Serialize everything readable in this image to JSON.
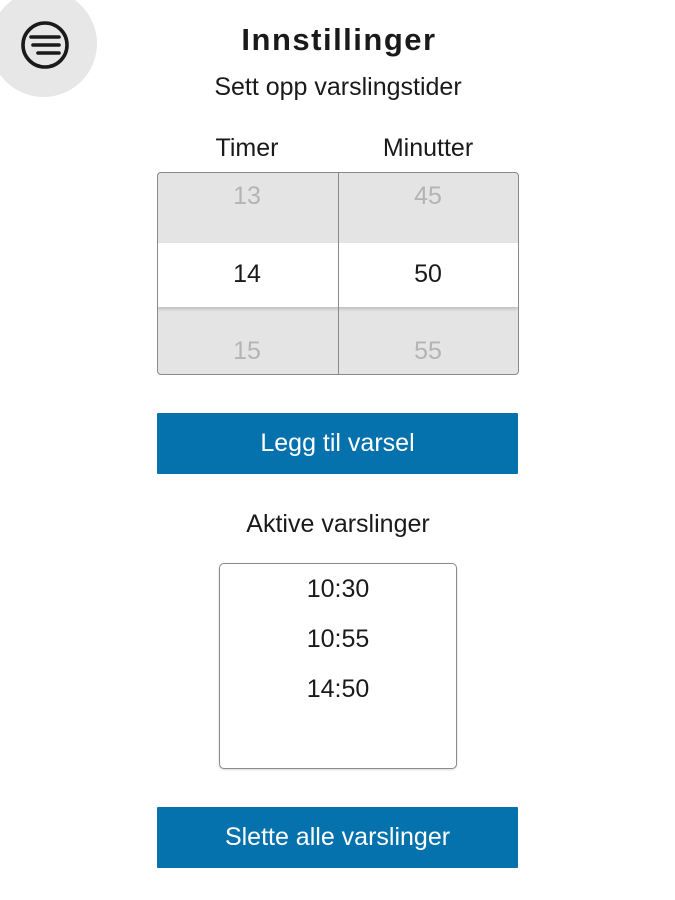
{
  "header": {
    "title": "Innstillinger",
    "subtitle": "Sett opp varslingstider",
    "menu_icon": "menu-lines-icon"
  },
  "picker": {
    "hours_label": "Timer",
    "minutes_label": "Minutter",
    "hours": {
      "prev": "13",
      "current": "14",
      "next": "15"
    },
    "minutes": {
      "prev": "45",
      "current": "50",
      "next": "55"
    }
  },
  "actions": {
    "add_label": "Legg til varsel",
    "delete_all_label": "Slette alle varslinger"
  },
  "alerts": {
    "label": "Aktive varslinger",
    "items": [
      "10:30",
      "10:55",
      "14:50"
    ]
  },
  "colors": {
    "accent": "#0571ad",
    "menu_background": "#e7e7e7",
    "picker_background": "#e4e4e4",
    "picker_muted_text": "#b4b4b4"
  }
}
